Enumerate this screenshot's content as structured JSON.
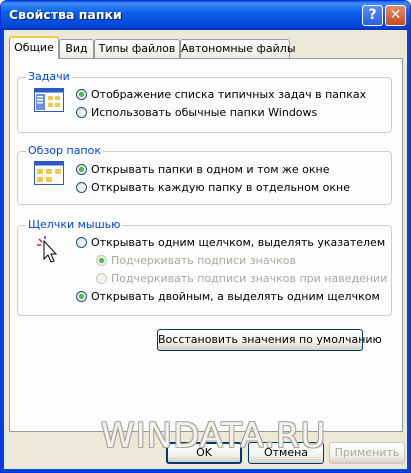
{
  "window": {
    "title": "Свойства папки"
  },
  "titlebar_buttons": {
    "help": "?",
    "close": "✕"
  },
  "tabs": [
    {
      "label": "Общие",
      "active": true
    },
    {
      "label": "Вид",
      "active": false
    },
    {
      "label": "Типы файлов",
      "active": false
    },
    {
      "label": "Автономные файлы",
      "active": false
    }
  ],
  "tasks": {
    "label": "Задачи",
    "options": [
      {
        "label": "Отображение списка типичных задач в папках",
        "checked": true
      },
      {
        "label": "Использовать обычные папки Windows",
        "checked": false
      }
    ]
  },
  "browse": {
    "label": "Обзор папок",
    "options": [
      {
        "label": "Открывать папки в одном и том же окне",
        "checked": true
      },
      {
        "label": "Открывать каждую папку в отдельном окне",
        "checked": false
      }
    ]
  },
  "clicks": {
    "label": "Щелчки мышью",
    "options": [
      {
        "label": "Открывать одним щелчком, выделять указателем",
        "checked": false,
        "enabled": true
      },
      {
        "label": "Подчеркивать подписи значков",
        "checked": true,
        "enabled": false
      },
      {
        "label": "Подчеркивать подписи значков при наведении",
        "checked": false,
        "enabled": false
      },
      {
        "label": "Открывать двойным, а выделять одним щелчком",
        "checked": true,
        "enabled": true
      }
    ]
  },
  "restore_button": "Восстановить значения по умолчанию",
  "buttons": {
    "ok": "OK",
    "cancel": "Отмена",
    "apply": "Применить"
  },
  "watermark": "WINDATA.RU",
  "colors": {
    "titlebar": "#0a5fea",
    "group_label": "#0046d5",
    "face": "#ece9d8"
  }
}
